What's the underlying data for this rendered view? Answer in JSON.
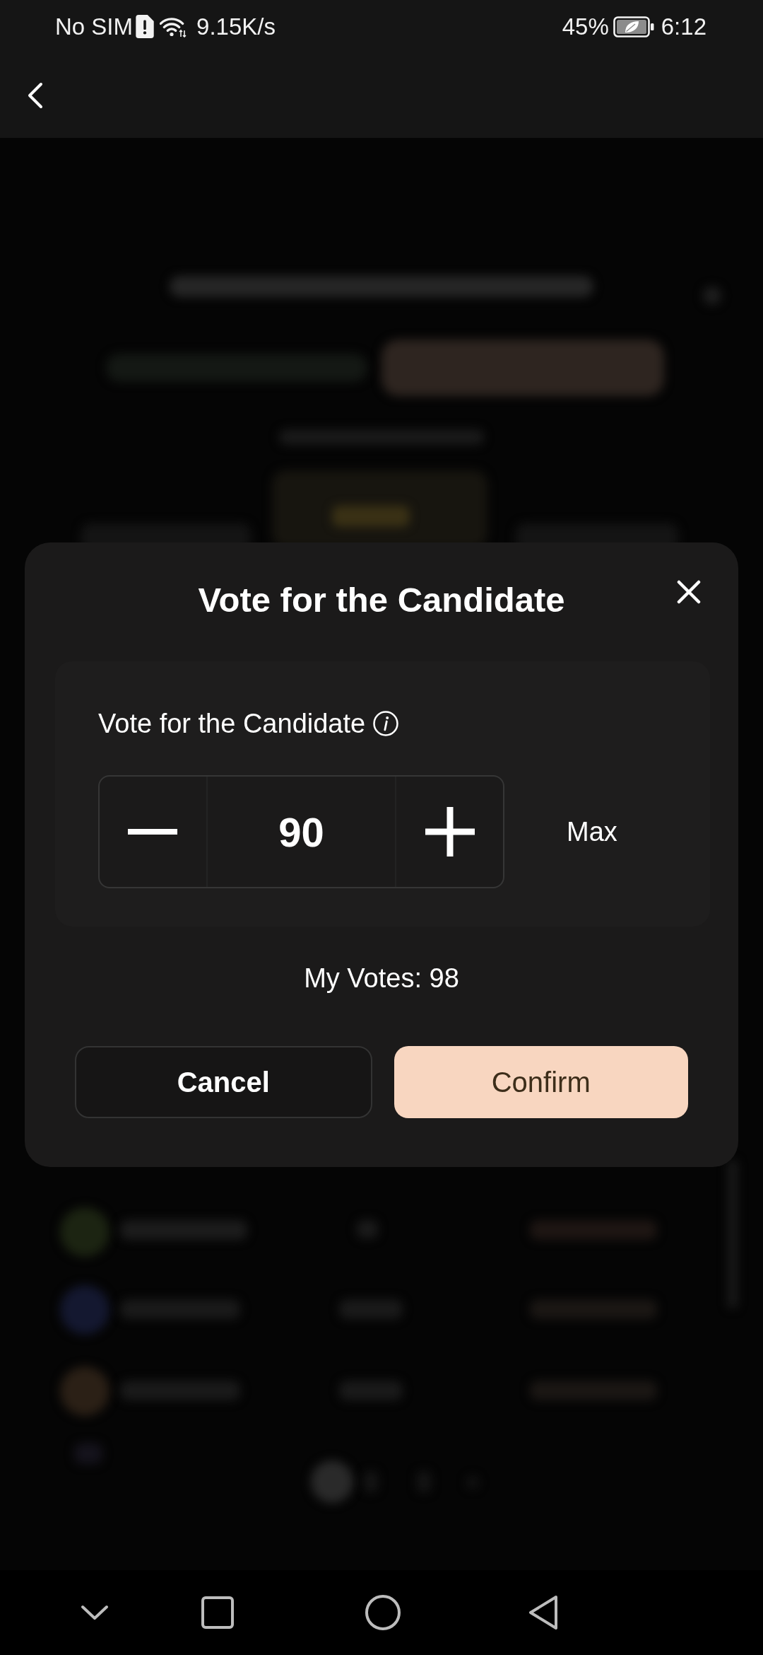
{
  "status_bar": {
    "carrier": "No SIM",
    "network_speed": "9.15K/s",
    "battery": "45%",
    "time": "6:12"
  },
  "dialog": {
    "title": "Vote for the Candidate",
    "label": "Vote for the Candidate",
    "stepper": {
      "value": "90"
    },
    "max_label": "Max",
    "my_votes": "My Votes: 98",
    "buttons": [
      {
        "label": "Cancel",
        "kind": "secondary"
      },
      {
        "label": "Confirm",
        "kind": "primary"
      }
    ]
  }
}
